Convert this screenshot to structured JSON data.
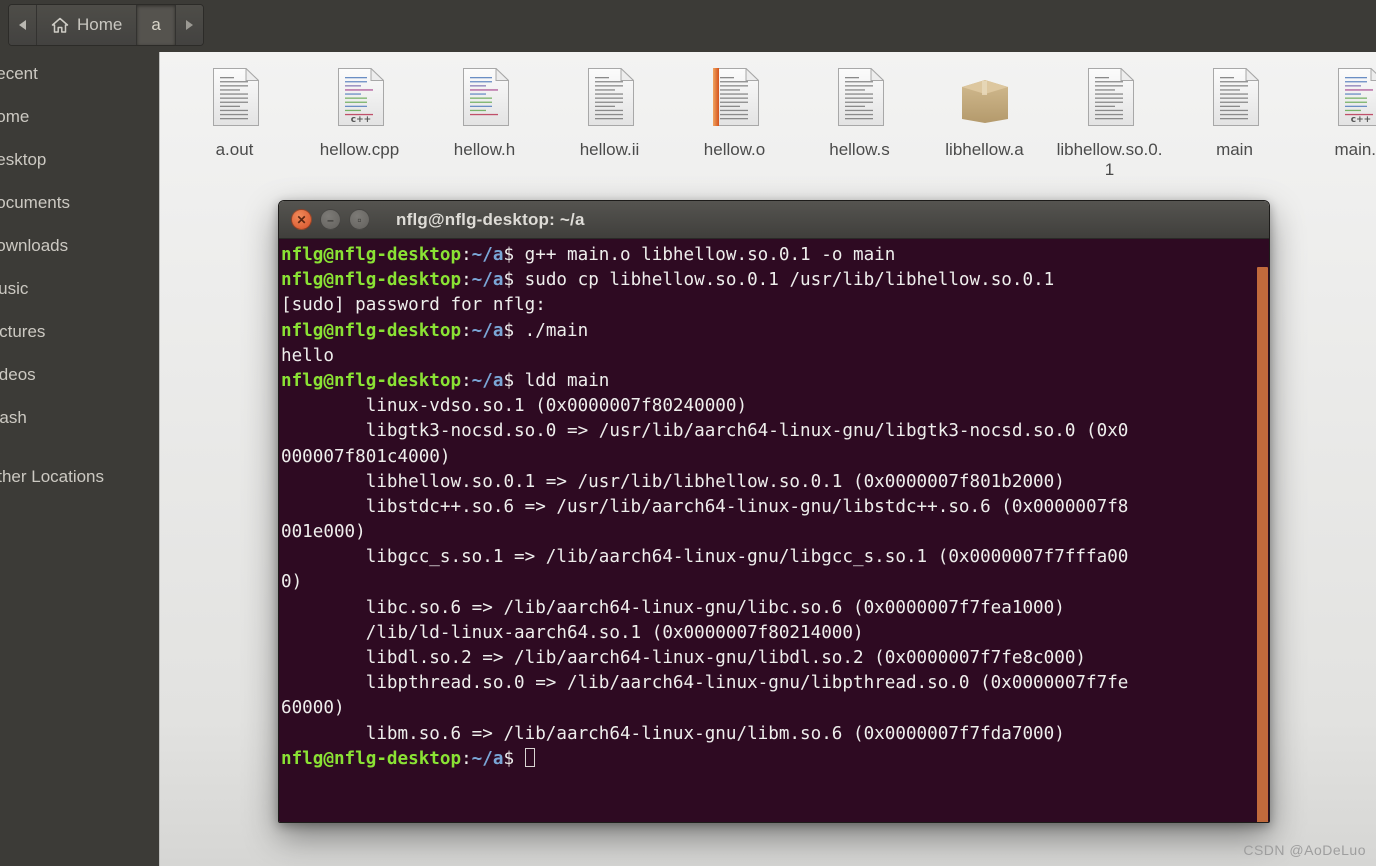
{
  "file_manager": {
    "breadcrumb": {
      "back_icon": "triangle-left-icon",
      "home_icon": "home-icon",
      "home_label": "Home",
      "current_label": "a",
      "forward_icon": "triangle-right-icon"
    },
    "sidebar": {
      "items": [
        {
          "label": "Recent",
          "icon": "clock-icon"
        },
        {
          "label": "Home",
          "icon": "home-icon"
        },
        {
          "label": "Desktop",
          "icon": "desktop-icon"
        },
        {
          "label": "Documents",
          "icon": "documents-icon"
        },
        {
          "label": "Downloads",
          "icon": "downloads-icon"
        },
        {
          "label": "Music",
          "icon": "music-icon"
        },
        {
          "label": "Pictures",
          "icon": "pictures-icon"
        },
        {
          "label": "Videos",
          "icon": "videos-icon"
        },
        {
          "label": "Trash",
          "icon": "trash-icon"
        },
        {
          "label": "Other Locations",
          "icon": "network-icon"
        }
      ]
    },
    "files": [
      {
        "name": "a.out",
        "icon": "text-document-icon",
        "kind": "plain"
      },
      {
        "name": "hellow.cpp",
        "icon": "cpp-source-icon",
        "kind": "cpp"
      },
      {
        "name": "hellow.h",
        "icon": "source-header-icon",
        "kind": "code"
      },
      {
        "name": "hellow.ii",
        "icon": "text-document-icon",
        "kind": "plain"
      },
      {
        "name": "hellow.o",
        "icon": "object-file-icon",
        "kind": "object"
      },
      {
        "name": "hellow.s",
        "icon": "text-document-icon",
        "kind": "plain"
      },
      {
        "name": "libhellow.a",
        "icon": "archive-package-icon",
        "kind": "package"
      },
      {
        "name": "libhellow.so.0.1",
        "icon": "text-document-icon",
        "kind": "plain"
      },
      {
        "name": "main",
        "icon": "text-document-icon",
        "kind": "plain"
      },
      {
        "name": "main.c",
        "icon": "cpp-source-icon",
        "kind": "cpp"
      }
    ]
  },
  "terminal": {
    "title": "nflg@nflg-desktop: ~/a",
    "window_buttons": {
      "close": "close-icon",
      "minimize": "minimize-icon",
      "maximize": "maximize-icon"
    },
    "prompt": {
      "user_host": "nflg@nflg-desktop",
      "colon": ":",
      "path": "~/a",
      "sigil": "$"
    },
    "lines": [
      {
        "type": "prompt",
        "cmd": " g++ main.o libhellow.so.0.1 -o main"
      },
      {
        "type": "prompt",
        "cmd": " sudo cp libhellow.so.0.1 /usr/lib/libhellow.so.0.1"
      },
      {
        "type": "out",
        "text": "[sudo] password for nflg:"
      },
      {
        "type": "prompt",
        "cmd": " ./main"
      },
      {
        "type": "out",
        "text": "hello"
      },
      {
        "type": "prompt",
        "cmd": " ldd main"
      },
      {
        "type": "out",
        "text": "        linux-vdso.so.1 (0x0000007f80240000)"
      },
      {
        "type": "out",
        "text": "        libgtk3-nocsd.so.0 => /usr/lib/aarch64-linux-gnu/libgtk3-nocsd.so.0 (0x0"
      },
      {
        "type": "out",
        "text": "000007f801c4000)"
      },
      {
        "type": "out",
        "text": "        libhellow.so.0.1 => /usr/lib/libhellow.so.0.1 (0x0000007f801b2000)"
      },
      {
        "type": "out",
        "text": "        libstdc++.so.6 => /usr/lib/aarch64-linux-gnu/libstdc++.so.6 (0x0000007f8"
      },
      {
        "type": "out",
        "text": "001e000)"
      },
      {
        "type": "out",
        "text": "        libgcc_s.so.1 => /lib/aarch64-linux-gnu/libgcc_s.so.1 (0x0000007f7fffa00"
      },
      {
        "type": "out",
        "text": "0)"
      },
      {
        "type": "out",
        "text": "        libc.so.6 => /lib/aarch64-linux-gnu/libc.so.6 (0x0000007f7fea1000)"
      },
      {
        "type": "out",
        "text": "        /lib/ld-linux-aarch64.so.1 (0x0000007f80214000)"
      },
      {
        "type": "out",
        "text": "        libdl.so.2 => /lib/aarch64-linux-gnu/libdl.so.2 (0x0000007f7fe8c000)"
      },
      {
        "type": "out",
        "text": "        libpthread.so.0 => /lib/aarch64-linux-gnu/libpthread.so.0 (0x0000007f7fe"
      },
      {
        "type": "out",
        "text": "60000)"
      },
      {
        "type": "out",
        "text": "        libm.so.6 => /lib/aarch64-linux-gnu/libm.so.6 (0x0000007f7fda7000)"
      },
      {
        "type": "prompt",
        "cmd": " ",
        "cursor": true
      }
    ],
    "colors": {
      "background": "#2e0a22",
      "prompt_user": "#8ae234",
      "prompt_path": "#7aa6d6",
      "text": "#e8e4e2",
      "scrollbar": "#c06a3c",
      "titlebar": "#474642"
    }
  },
  "watermark": {
    "text": "CSDN @AoDeLuo"
  }
}
